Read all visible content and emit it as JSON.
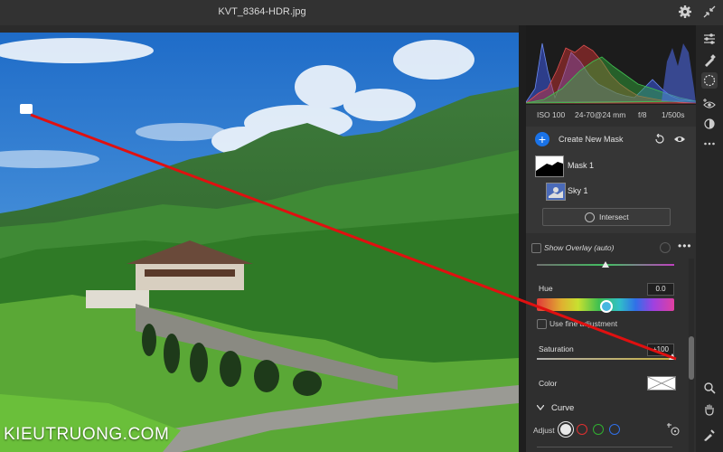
{
  "window": {
    "title": "KVT_8364-HDR.jpg"
  },
  "watermark": "KIEUTRUONG.COM",
  "meta": {
    "iso": "ISO 100",
    "lens": "24-70@24 mm",
    "aperture": "f/8",
    "shutter": "1/500s"
  },
  "mask_panel": {
    "create_label": "Create New Mask",
    "masks": [
      {
        "label": "Mask 1"
      },
      {
        "label": "Sky 1"
      }
    ],
    "intersect_label": "Intersect"
  },
  "overlay": {
    "label": "Show Overlay (auto)",
    "checked": false,
    "more_icon": "ellipsis-icon"
  },
  "settings": {
    "hue": {
      "label": "Hue",
      "value": "0.0",
      "position": 0.5
    },
    "fine_adjust": {
      "label": "Use fine adjustment",
      "checked": false
    },
    "saturation": {
      "label": "Saturation",
      "value": "+100",
      "position": 1.0
    },
    "top_slider_position": 0.5,
    "color": {
      "label": "Color",
      "value": "none"
    }
  },
  "curve": {
    "label": "Curve",
    "adjust_label": "Adjust",
    "channels": [
      {
        "name": "white",
        "color": "#e8e8e8",
        "selected": true
      },
      {
        "name": "red",
        "color": "#e03030",
        "selected": false
      },
      {
        "name": "green",
        "color": "#30b030",
        "selected": false
      },
      {
        "name": "blue",
        "color": "#3070e8",
        "selected": false
      }
    ]
  },
  "toolstrip": [
    {
      "name": "edit-sliders-icon"
    },
    {
      "name": "healing-brush-icon"
    },
    {
      "name": "masking-icon",
      "active": true
    },
    {
      "name": "red-eye-icon"
    },
    {
      "name": "presets-icon"
    },
    {
      "name": "more-icon"
    },
    {
      "name": "zoom-icon"
    },
    {
      "name": "hand-icon"
    },
    {
      "name": "eyedropper-icon"
    }
  ],
  "colors": {
    "accent": "#1a73e8",
    "annotation": "#e01010"
  }
}
